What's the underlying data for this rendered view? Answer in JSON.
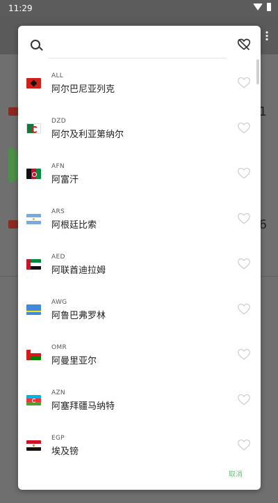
{
  "status_bar": {
    "time": "11:29"
  },
  "background": {
    "values": [
      "1",
      "6"
    ]
  },
  "search": {
    "placeholder": "",
    "value": ""
  },
  "currencies": [
    {
      "code": "ALL",
      "name": "阿尔巴尼亚列克",
      "flag": "albania-flag"
    },
    {
      "code": "DZD",
      "name": "阿尔及利亚第纳尔",
      "flag": "algeria-flag"
    },
    {
      "code": "AFN",
      "name": "阿富汗",
      "flag": "afghanistan-flag"
    },
    {
      "code": "ARS",
      "name": "阿根廷比索",
      "flag": "argentina-flag"
    },
    {
      "code": "AED",
      "name": "阿联酋迪拉姆",
      "flag": "uae-flag"
    },
    {
      "code": "AWG",
      "name": "阿鲁巴弗罗林",
      "flag": "aruba-flag"
    },
    {
      "code": "OMR",
      "name": "阿曼里亚尔",
      "flag": "oman-flag"
    },
    {
      "code": "AZN",
      "name": "阿塞拜疆马纳特",
      "flag": "azerbaijan-flag"
    },
    {
      "code": "EGP",
      "name": "埃及镑",
      "flag": "egypt-flag"
    }
  ],
  "actions": {
    "cancel_label": "取消"
  },
  "colors": {
    "accent": "#6cc07a",
    "dialog": "#ffffff",
    "scrim": "#7a7a7a"
  }
}
